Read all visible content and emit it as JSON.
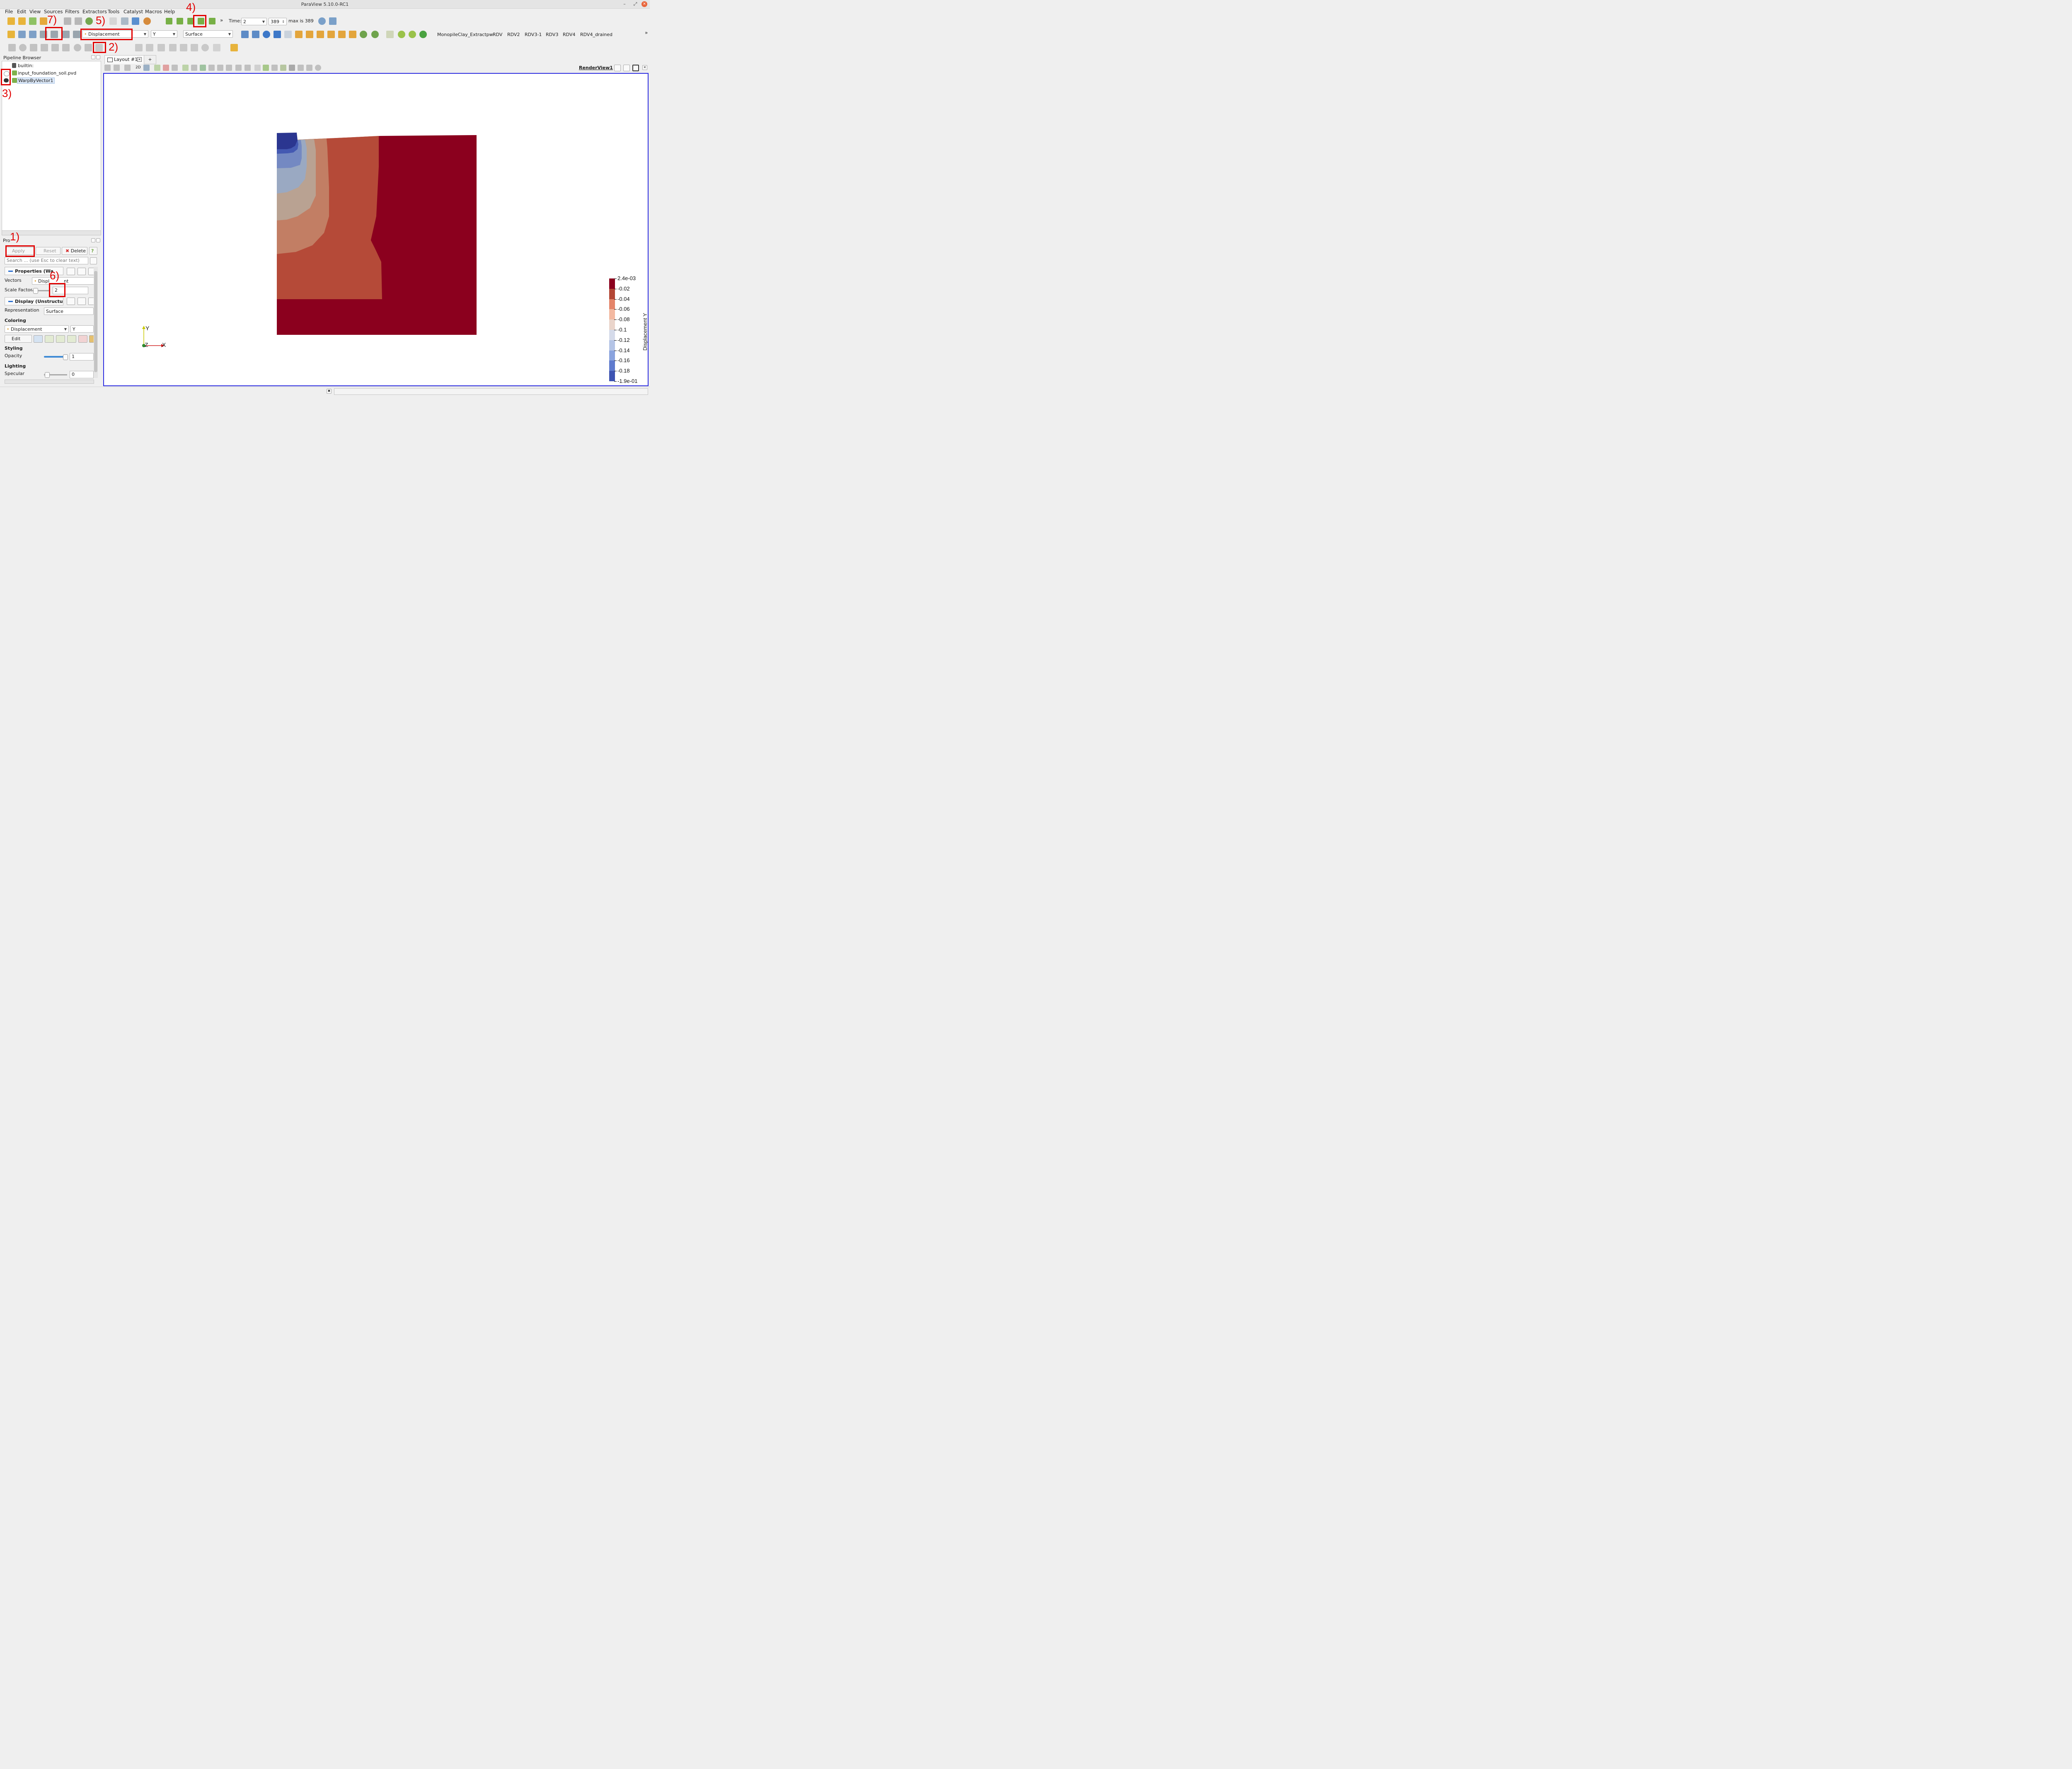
{
  "app": {
    "title": "ParaView 5.10.0-RC1"
  },
  "menu": [
    "File",
    "Edit",
    "View",
    "Sources",
    "Filters",
    "Extractors",
    "Tools",
    "Catalyst",
    "Macros",
    "Help"
  ],
  "time_toolbar": {
    "time_label": "Time:",
    "time_value": "2",
    "step_value": "389",
    "max_text": "max is 389"
  },
  "color_toolbar": {
    "array": "Displacement",
    "component": "Y",
    "representation": "Surface"
  },
  "camera_bookmarks": [
    "MonopileClay_Extractpw",
    "RDV",
    "RDV2",
    "RDV3-1",
    "RDV3",
    "RDV4",
    "RDV4_drained"
  ],
  "toolbar_more": "»",
  "pipeline": {
    "title": "Pipeline Browser",
    "items": [
      "builtin:",
      "input_foundation_soil.pvd",
      "WarpByVector1"
    ]
  },
  "properties": {
    "title": "Pro",
    "apply": "Apply",
    "reset": "Reset",
    "delete": "Delete",
    "help": "?",
    "search_placeholder": "Search ... (use Esc to clear text)",
    "section_properties": "Properties (Wa",
    "vectors_label": "Vectors",
    "vectors_value_a": "Displ",
    "vectors_value_b": "nt",
    "scale_label": "Scale Factor",
    "scale_value": "2",
    "section_display": "Display (Unstructur",
    "representation_label": "Representation",
    "representation_value": "Surface",
    "coloring_header": "Coloring",
    "coloring_array": "Displacement",
    "coloring_component": "Y",
    "edit_label": "Edit",
    "styling_header": "Styling",
    "opacity_label": "Opacity",
    "opacity_value": "1",
    "lighting_header": "Lighting",
    "specular_label": "Specular",
    "specular_value": "0"
  },
  "layout": {
    "tab": "Layout #1",
    "add": "+",
    "view_name": "RenderView1",
    "btn_2d": "2D"
  },
  "annotations": [
    "1)",
    "2)",
    "3)",
    "4)",
    "5)",
    "6)",
    "7)"
  ],
  "axes": {
    "x": "X",
    "y": "Y",
    "z": "Z"
  },
  "colors": {
    "red_dark": "#8b001e",
    "red_mid": "#b54a38",
    "salmon": "#c27e64",
    "tan": "#b9a292",
    "blue_light": "#9aa9c2",
    "blue_mid": "#7489c2",
    "blue_strong": "#4459b2",
    "blue_dark": "#2b3690",
    "border_view": "#2c2ce0",
    "annotation_red": "#e10000"
  },
  "chart_data": {
    "type": "heatmap",
    "ylabel": "Displacement Y",
    "scalar_range": [
      -0.19,
      0.0024
    ],
    "tick_labels": [
      "2.4e-03",
      "-0.02",
      "-0.04",
      "-0.06",
      "-0.08",
      "-0.1",
      "-0.12",
      "-0.14",
      "-0.16",
      "-0.18",
      "-1.9e-01"
    ],
    "bands": [
      "#8b001e",
      "#b34735",
      "#e4856a",
      "#f3b9a1",
      "#ead5cb",
      "#d5dbea",
      "#b4c4e6",
      "#8aa3de",
      "#5f7bce",
      "#3d53b2"
    ]
  }
}
